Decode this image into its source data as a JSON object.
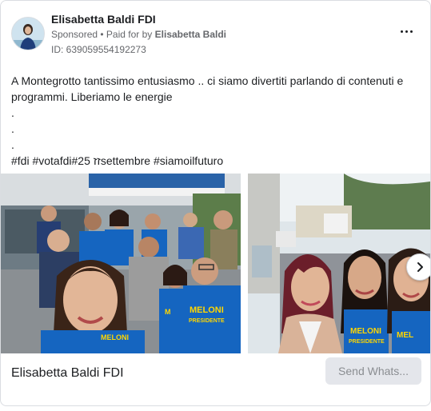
{
  "post": {
    "author": "Elisabetta Baldi FDI",
    "sponsored": "Sponsored",
    "paid_prefix": "• Paid for by",
    "paid_by": "Elisabetta Baldi",
    "ad_id": "ID: 639059554192273",
    "more_icon": "more-horizontal-icon"
  },
  "body": {
    "lines": [
      "A Montegrotto tantissimo entusiasmo .. ci siamo divertiti parlando di contenuti e programmi. Liberiamo le energie",
      ".",
      ".",
      ".",
      "#fdi #votafdiזז #25settembre #siamoilfuturo"
    ]
  },
  "carousel": {
    "slides": [
      {
        "shirt_text_1": "MELONI",
        "shirt_text_2": "PRESIDENTE"
      },
      {
        "shirt_text_1": "MELONI",
        "shirt_text_2": "PRESIDENTE"
      }
    ],
    "next_icon": "chevron-right-icon"
  },
  "footer": {
    "caption": "Elisabetta Baldi FDI",
    "cta_label": "Send Whats..."
  },
  "colors": {
    "text_primary": "#1c1e21",
    "text_secondary": "#65676b",
    "cta_bg": "#e4e6eb",
    "shirt_blue": "#1565c0",
    "shirt_yellow": "#ffd600"
  }
}
